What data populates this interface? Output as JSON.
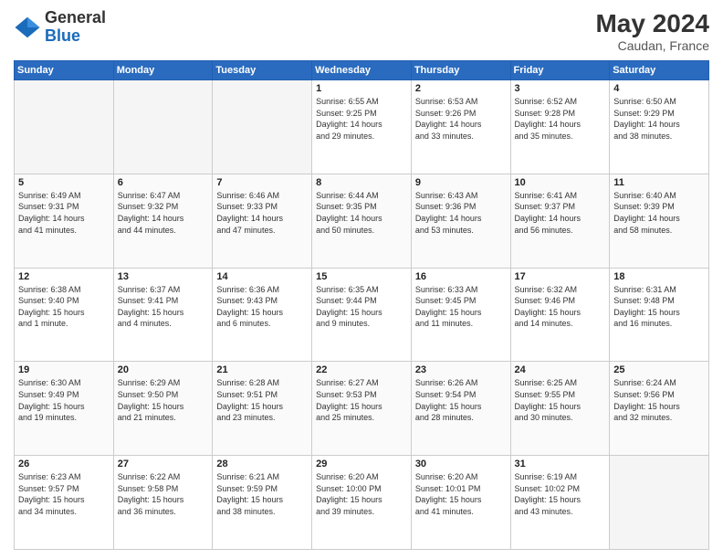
{
  "header": {
    "logo": {
      "line1": "General",
      "line2": "Blue"
    },
    "title": "May 2024",
    "location": "Caudan, France"
  },
  "weekdays": [
    "Sunday",
    "Monday",
    "Tuesday",
    "Wednesday",
    "Thursday",
    "Friday",
    "Saturday"
  ],
  "weeks": [
    [
      {
        "day": "",
        "info": ""
      },
      {
        "day": "",
        "info": ""
      },
      {
        "day": "",
        "info": ""
      },
      {
        "day": "1",
        "info": "Sunrise: 6:55 AM\nSunset: 9:25 PM\nDaylight: 14 hours\nand 29 minutes."
      },
      {
        "day": "2",
        "info": "Sunrise: 6:53 AM\nSunset: 9:26 PM\nDaylight: 14 hours\nand 33 minutes."
      },
      {
        "day": "3",
        "info": "Sunrise: 6:52 AM\nSunset: 9:28 PM\nDaylight: 14 hours\nand 35 minutes."
      },
      {
        "day": "4",
        "info": "Sunrise: 6:50 AM\nSunset: 9:29 PM\nDaylight: 14 hours\nand 38 minutes."
      }
    ],
    [
      {
        "day": "5",
        "info": "Sunrise: 6:49 AM\nSunset: 9:31 PM\nDaylight: 14 hours\nand 41 minutes."
      },
      {
        "day": "6",
        "info": "Sunrise: 6:47 AM\nSunset: 9:32 PM\nDaylight: 14 hours\nand 44 minutes."
      },
      {
        "day": "7",
        "info": "Sunrise: 6:46 AM\nSunset: 9:33 PM\nDaylight: 14 hours\nand 47 minutes."
      },
      {
        "day": "8",
        "info": "Sunrise: 6:44 AM\nSunset: 9:35 PM\nDaylight: 14 hours\nand 50 minutes."
      },
      {
        "day": "9",
        "info": "Sunrise: 6:43 AM\nSunset: 9:36 PM\nDaylight: 14 hours\nand 53 minutes."
      },
      {
        "day": "10",
        "info": "Sunrise: 6:41 AM\nSunset: 9:37 PM\nDaylight: 14 hours\nand 56 minutes."
      },
      {
        "day": "11",
        "info": "Sunrise: 6:40 AM\nSunset: 9:39 PM\nDaylight: 14 hours\nand 58 minutes."
      }
    ],
    [
      {
        "day": "12",
        "info": "Sunrise: 6:38 AM\nSunset: 9:40 PM\nDaylight: 15 hours\nand 1 minute."
      },
      {
        "day": "13",
        "info": "Sunrise: 6:37 AM\nSunset: 9:41 PM\nDaylight: 15 hours\nand 4 minutes."
      },
      {
        "day": "14",
        "info": "Sunrise: 6:36 AM\nSunset: 9:43 PM\nDaylight: 15 hours\nand 6 minutes."
      },
      {
        "day": "15",
        "info": "Sunrise: 6:35 AM\nSunset: 9:44 PM\nDaylight: 15 hours\nand 9 minutes."
      },
      {
        "day": "16",
        "info": "Sunrise: 6:33 AM\nSunset: 9:45 PM\nDaylight: 15 hours\nand 11 minutes."
      },
      {
        "day": "17",
        "info": "Sunrise: 6:32 AM\nSunset: 9:46 PM\nDaylight: 15 hours\nand 14 minutes."
      },
      {
        "day": "18",
        "info": "Sunrise: 6:31 AM\nSunset: 9:48 PM\nDaylight: 15 hours\nand 16 minutes."
      }
    ],
    [
      {
        "day": "19",
        "info": "Sunrise: 6:30 AM\nSunset: 9:49 PM\nDaylight: 15 hours\nand 19 minutes."
      },
      {
        "day": "20",
        "info": "Sunrise: 6:29 AM\nSunset: 9:50 PM\nDaylight: 15 hours\nand 21 minutes."
      },
      {
        "day": "21",
        "info": "Sunrise: 6:28 AM\nSunset: 9:51 PM\nDaylight: 15 hours\nand 23 minutes."
      },
      {
        "day": "22",
        "info": "Sunrise: 6:27 AM\nSunset: 9:53 PM\nDaylight: 15 hours\nand 25 minutes."
      },
      {
        "day": "23",
        "info": "Sunrise: 6:26 AM\nSunset: 9:54 PM\nDaylight: 15 hours\nand 28 minutes."
      },
      {
        "day": "24",
        "info": "Sunrise: 6:25 AM\nSunset: 9:55 PM\nDaylight: 15 hours\nand 30 minutes."
      },
      {
        "day": "25",
        "info": "Sunrise: 6:24 AM\nSunset: 9:56 PM\nDaylight: 15 hours\nand 32 minutes."
      }
    ],
    [
      {
        "day": "26",
        "info": "Sunrise: 6:23 AM\nSunset: 9:57 PM\nDaylight: 15 hours\nand 34 minutes."
      },
      {
        "day": "27",
        "info": "Sunrise: 6:22 AM\nSunset: 9:58 PM\nDaylight: 15 hours\nand 36 minutes."
      },
      {
        "day": "28",
        "info": "Sunrise: 6:21 AM\nSunset: 9:59 PM\nDaylight: 15 hours\nand 38 minutes."
      },
      {
        "day": "29",
        "info": "Sunrise: 6:20 AM\nSunset: 10:00 PM\nDaylight: 15 hours\nand 39 minutes."
      },
      {
        "day": "30",
        "info": "Sunrise: 6:20 AM\nSunset: 10:01 PM\nDaylight: 15 hours\nand 41 minutes."
      },
      {
        "day": "31",
        "info": "Sunrise: 6:19 AM\nSunset: 10:02 PM\nDaylight: 15 hours\nand 43 minutes."
      },
      {
        "day": "",
        "info": ""
      }
    ]
  ]
}
